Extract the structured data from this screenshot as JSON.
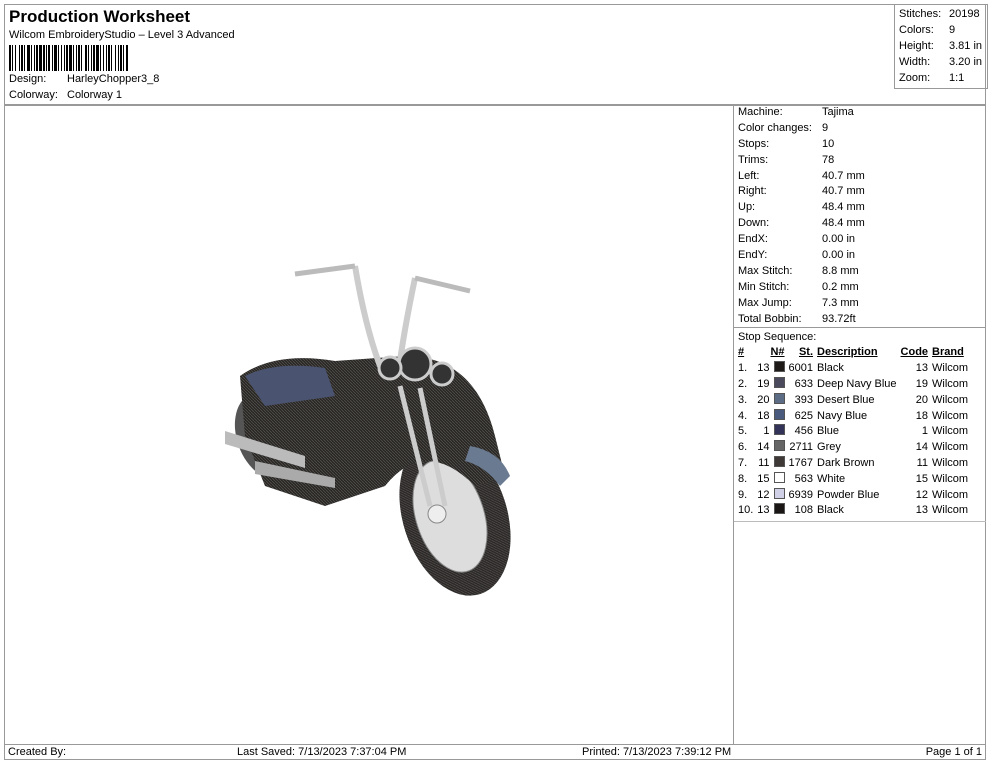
{
  "header": {
    "title": "Production Worksheet",
    "subtitle": "Wilcom EmbroideryStudio – Level 3 Advanced",
    "design_label": "Design:",
    "design": "HarleyChopper3_8",
    "colorway_label": "Colorway:",
    "colorway": "Colorway 1"
  },
  "stats": [
    {
      "k": "Stitches:",
      "v": "20198"
    },
    {
      "k": "Colors:",
      "v": "9"
    },
    {
      "k": "Height:",
      "v": "3.81 in"
    },
    {
      "k": "Width:",
      "v": "3.20 in"
    },
    {
      "k": "Zoom:",
      "v": "1:1"
    }
  ],
  "info": [
    {
      "k": "Machine:",
      "v": "Tajima"
    },
    {
      "k": "Color changes:",
      "v": "9"
    },
    {
      "k": "Stops:",
      "v": "10"
    },
    {
      "k": "Trims:",
      "v": "78"
    },
    {
      "k": "Left:",
      "v": "40.7 mm"
    },
    {
      "k": "Right:",
      "v": "40.7 mm"
    },
    {
      "k": "Up:",
      "v": "48.4 mm"
    },
    {
      "k": "Down:",
      "v": "48.4 mm"
    },
    {
      "k": "EndX:",
      "v": "0.00 in"
    },
    {
      "k": "EndY:",
      "v": "0.00 in"
    },
    {
      "k": "Max Stitch:",
      "v": "8.8 mm"
    },
    {
      "k": "Min Stitch:",
      "v": "0.2 mm"
    },
    {
      "k": "Max Jump:",
      "v": "7.3 mm"
    },
    {
      "k": "Total Bobbin:",
      "v": "93.72ft"
    }
  ],
  "stop_sequence": {
    "title": "Stop Sequence:",
    "columns": [
      "#",
      "N#",
      "St.",
      "Description",
      "Code",
      "Brand"
    ],
    "rows": [
      {
        "n": "1.",
        "needle": "13",
        "color": "#1e1a18",
        "st": "6001",
        "desc": "Black",
        "code": "13",
        "brand": "Wilcom"
      },
      {
        "n": "2.",
        "needle": "19",
        "color": "#4a4a5c",
        "st": "633",
        "desc": "Deep Navy Blue",
        "code": "19",
        "brand": "Wilcom"
      },
      {
        "n": "3.",
        "needle": "20",
        "color": "#5c6c84",
        "st": "393",
        "desc": "Desert Blue",
        "code": "20",
        "brand": "Wilcom"
      },
      {
        "n": "4.",
        "needle": "18",
        "color": "#4a5a7c",
        "st": "625",
        "desc": "Navy Blue",
        "code": "18",
        "brand": "Wilcom"
      },
      {
        "n": "5.",
        "needle": "1",
        "color": "#33335a",
        "st": "456",
        "desc": "Blue",
        "code": "1",
        "brand": "Wilcom"
      },
      {
        "n": "6.",
        "needle": "14",
        "color": "#666666",
        "st": "2711",
        "desc": "Grey",
        "code": "14",
        "brand": "Wilcom"
      },
      {
        "n": "7.",
        "needle": "11",
        "color": "#3e3836",
        "st": "1767",
        "desc": "Dark Brown",
        "code": "11",
        "brand": "Wilcom"
      },
      {
        "n": "8.",
        "needle": "15",
        "color": "#ffffff",
        "st": "563",
        "desc": "White",
        "code": "15",
        "brand": "Wilcom"
      },
      {
        "n": "9.",
        "needle": "12",
        "color": "#d0d0e6",
        "st": "6939",
        "desc": "Powder Blue",
        "code": "12",
        "brand": "Wilcom"
      },
      {
        "n": "10.",
        "needle": "13",
        "color": "#1a1616",
        "st": "108",
        "desc": "Black",
        "code": "13",
        "brand": "Wilcom"
      }
    ]
  },
  "footer": {
    "created": "Created By:",
    "saved": "Last Saved: 7/13/2023 7:37:04 PM",
    "printed": "Printed: 7/13/2023 7:39:12 PM",
    "page": "Page 1 of 1"
  }
}
